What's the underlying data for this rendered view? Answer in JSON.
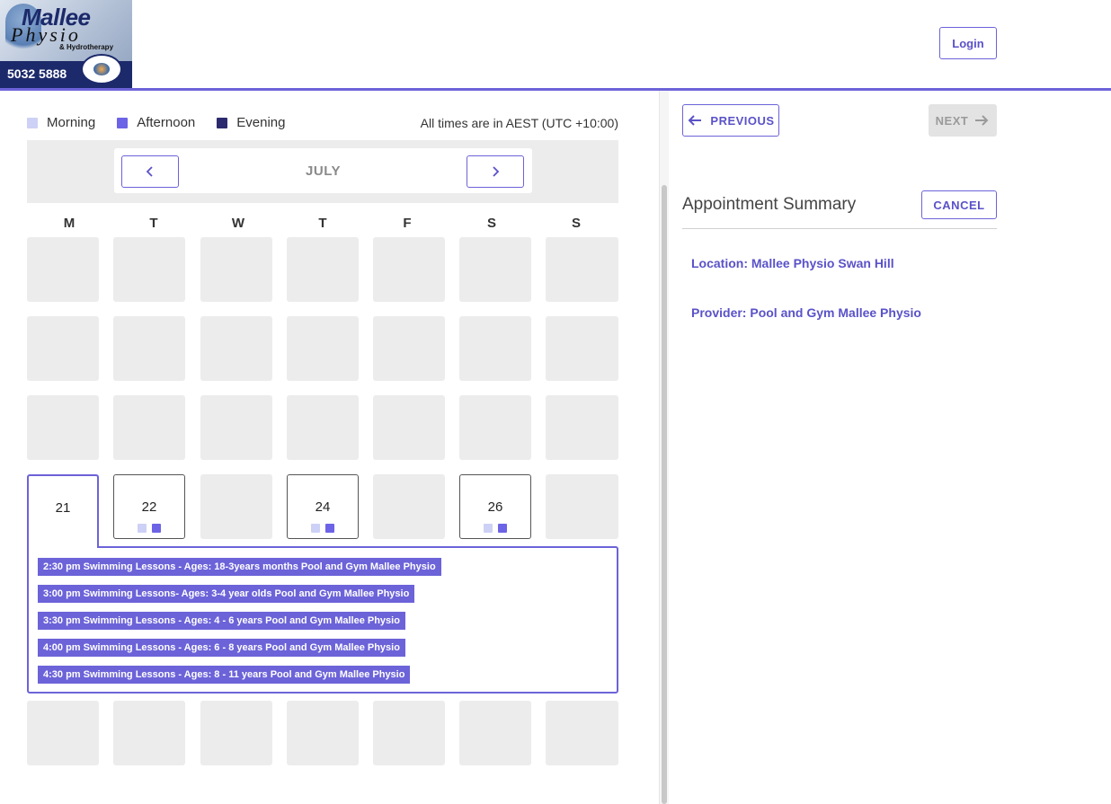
{
  "header": {
    "logo": {
      "brand_line1": "Mallee",
      "brand_line2": "Physio",
      "brand_line3": "& Hydrotherapy",
      "phone": "5032 5888"
    },
    "login_label": "Login"
  },
  "legend": [
    {
      "label": "Morning",
      "color": "#cdd1f5"
    },
    {
      "label": "Afternoon",
      "color": "#6c63e6"
    },
    {
      "label": "Evening",
      "color": "#2b2a6e"
    }
  ],
  "timezone_note": "All times are in AEST (UTC +10:00)",
  "calendar": {
    "month": "JULY",
    "prev_icon": "chevron-left-icon",
    "next_icon": "chevron-right-icon",
    "weekdays": [
      "M",
      "T",
      "W",
      "T",
      "F",
      "S",
      "S"
    ],
    "available_days": [
      {
        "day": "21",
        "selected": true,
        "slots": []
      },
      {
        "day": "22",
        "selected": false,
        "slots": [
          "morning",
          "afternoon"
        ]
      },
      {
        "day": "24",
        "selected": false,
        "slots": [
          "morning",
          "afternoon"
        ]
      },
      {
        "day": "26",
        "selected": false,
        "slots": [
          "morning",
          "afternoon"
        ]
      }
    ],
    "time_slots": [
      "2:30 pm Swimming Lessons - Ages: 18-3years months Pool and Gym Mallee Physio",
      "3:00 pm Swimming Lessons- Ages: 3-4 year olds Pool and Gym Mallee Physio",
      "3:30 pm Swimming Lessons - Ages: 4 - 6 years Pool and Gym Mallee Physio",
      "4:00 pm Swimming Lessons - Ages: 6 - 8 years Pool and Gym Mallee Physio",
      "4:30 pm Swimming Lessons - Ages: 8 - 11 years Pool and Gym Mallee Physio"
    ]
  },
  "summary": {
    "previous_label": "PREVIOUS",
    "next_label": "NEXT",
    "title": "Appointment Summary",
    "cancel_label": "CANCEL",
    "location": "Location: Mallee Physio Swan Hill",
    "provider": "Provider: Pool and Gym Mallee Physio"
  },
  "colors": {
    "accent": "#6c63d9",
    "disabled": "#e3e3e3",
    "empty_cell": "#ececec"
  }
}
